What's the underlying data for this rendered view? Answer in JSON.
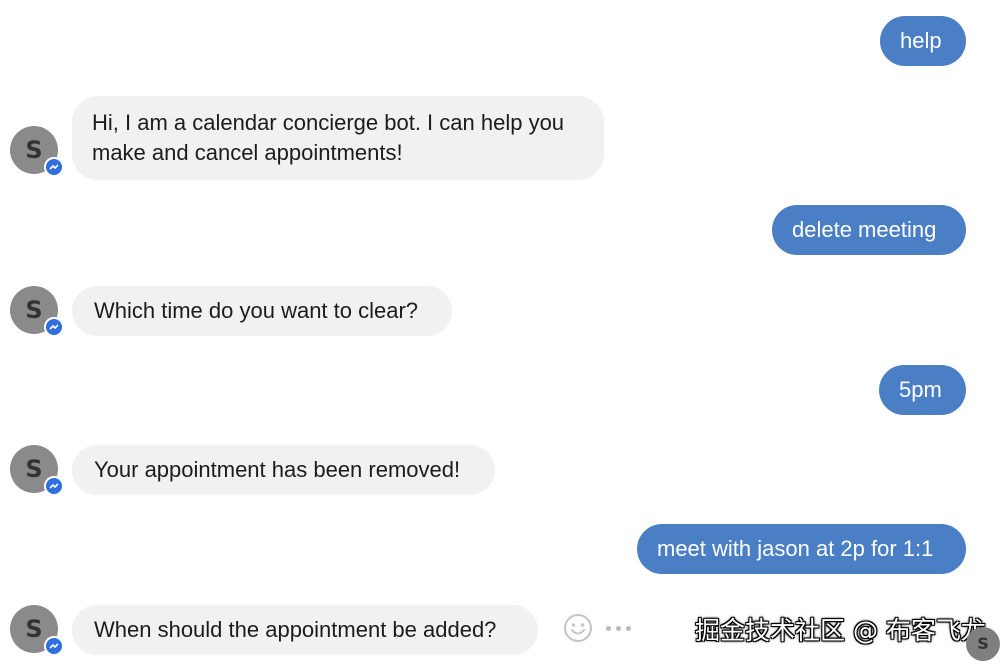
{
  "conversation": {
    "avatar_letter": "S",
    "messages": [
      {
        "sender": "user",
        "text": "help"
      },
      {
        "sender": "bot",
        "lines": [
          "Hi, I am a calendar concierge bot. I can help you",
          "make and cancel appointments!"
        ]
      },
      {
        "sender": "user",
        "text": "delete meeting"
      },
      {
        "sender": "bot",
        "text": "Which time do you want to clear?"
      },
      {
        "sender": "user",
        "text": "5pm"
      },
      {
        "sender": "bot",
        "text": "Your appointment has been removed!"
      },
      {
        "sender": "user",
        "text": "meet with jason at 2p for 1:1"
      },
      {
        "sender": "bot",
        "text": "When should the appointment be added?"
      }
    ]
  },
  "actions": {
    "emoji_icon": "smiley-face-icon",
    "more_icon": "more-options-icon"
  },
  "watermark": {
    "text": "掘金技术社区 @ 布客飞龙",
    "avatar_letter": "S"
  },
  "colors": {
    "user_bubble": "#4a7ec5",
    "bot_bubble": "#f1f1f1",
    "avatar": "#8a8a8a",
    "messenger_badge": "#2f6fdb"
  }
}
